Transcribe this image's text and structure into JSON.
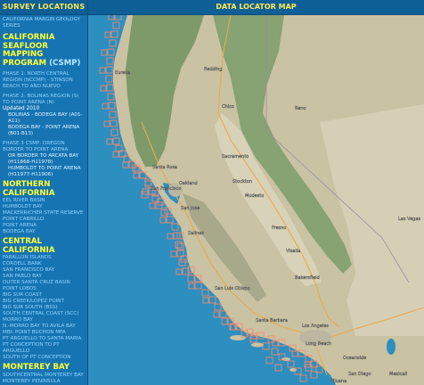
{
  "sidebar": {
    "header": "SURVEY LOCATIONS",
    "series_link": "CALIFORNIA MARGIN GEOLOGY SERIES",
    "csmp_title_line1": "CALIFORNIA",
    "csmp_title_line2": "SEAFLOOR MAPPING",
    "csmp_title_line3": "PROGRAM",
    "csmp_abbrev": "(CSMP)",
    "phase1": "PHASE 1: NORTH CENTRAL REGION (NCCMP) - STINSON BEACH TO AÑO NUEVO",
    "phase2": "PHASE 2: BOLINAS REGION (S) TO POINT ARENA (N)",
    "updated": "Updated 2010",
    "phase2_items": [
      "Bolinas - Bodega Bay (A01-A11)",
      "Bodega Bay - Point Arena (B01-B13)"
    ],
    "phase3": "PHASE 3 CSMP: OREGON BORDER TO POINT ARENA",
    "phase3_items": [
      "OR border to Arcata Bay (H11868-H11978)",
      "Humboldt to Point Arena (H11977-H11906)"
    ],
    "northern_title": "NORTHERN CALIFORNIA",
    "northern_items": [
      "EEL RIVER BASIN",
      "HUMBOLDT BAY",
      "MACKERRICHER STATE RESERVE",
      "POINT CABRILLO",
      "POINT ARENA",
      "BODEGA BAY"
    ],
    "central_title": "CENTRAL CALIFORNIA",
    "central_items": [
      "FARALLON ISLANDS",
      "CORDELL BANK",
      "SAN FRANCISCO BAY",
      "SAN PABLO BAY",
      "OUTER SANTA CRUZ BASIN",
      "POINT LOBOS",
      "BIG SUR COAST",
      "BIG CREEK/LOPEZ POINT",
      "BIG SUR SOUTH (BSS)",
      "SOUTH CENTRAL COAST (SCC)",
      "MORRO BAY",
      "N.-MORRO BAY TO AVILA BAY",
      "MBI: POINT BUCHON MPA",
      "PT ARGUELLO TO SANTA MARIA",
      "PT CONCEPTION TO PT ARGUELLO",
      "SOUTH OF PT CONCEPTION"
    ],
    "monterey_title": "MONTEREY BAY",
    "monterey_items": [
      "SOUTHCENTRAL MONTEREY BAY",
      "MONTEREY PENINSULA"
    ]
  },
  "main": {
    "header": "DATA LOCATOR MAP"
  },
  "map": {
    "ocean_color": "#2d8fbf",
    "land_color": "#c9c2a3",
    "forest_color": "#7e9a6a",
    "valley_color": "#d8d2b8",
    "box_color": "#ff8866",
    "labels": [
      {
        "id": "eureka",
        "text": "Eureka"
      },
      {
        "id": "redding",
        "text": "Redding"
      },
      {
        "id": "chico",
        "text": "Chico"
      },
      {
        "id": "santarosa",
        "text": "Santa Rosa"
      },
      {
        "id": "sacramento",
        "text": "Sacramento"
      },
      {
        "id": "sf",
        "text": "San Francisco"
      },
      {
        "id": "oakland",
        "text": "Oakland"
      },
      {
        "id": "stockton",
        "text": "Stockton"
      },
      {
        "id": "sanjose",
        "text": "San Jose"
      },
      {
        "id": "modesto",
        "text": "Modesto"
      },
      {
        "id": "salinas",
        "text": "Salinas"
      },
      {
        "id": "fresno",
        "text": "Fresno"
      },
      {
        "id": "visalia",
        "text": "Visalia"
      },
      {
        "id": "bakersfield",
        "text": "Bakersfield"
      },
      {
        "id": "slo",
        "text": "San Luis Obispo"
      },
      {
        "id": "santabarbara",
        "text": "Santa Barbara"
      },
      {
        "id": "la",
        "text": "Los Angeles"
      },
      {
        "id": "lb",
        "text": "Long Beach"
      },
      {
        "id": "oceanside",
        "text": "Oceanside"
      },
      {
        "id": "sandiego",
        "text": "San Diego"
      },
      {
        "id": "tijuana",
        "text": "Tijuana"
      },
      {
        "id": "mexicali",
        "text": "Mexicali"
      },
      {
        "id": "renoarea",
        "text": "Reno"
      },
      {
        "id": "lasvegas",
        "text": "Las Vegas"
      }
    ]
  }
}
